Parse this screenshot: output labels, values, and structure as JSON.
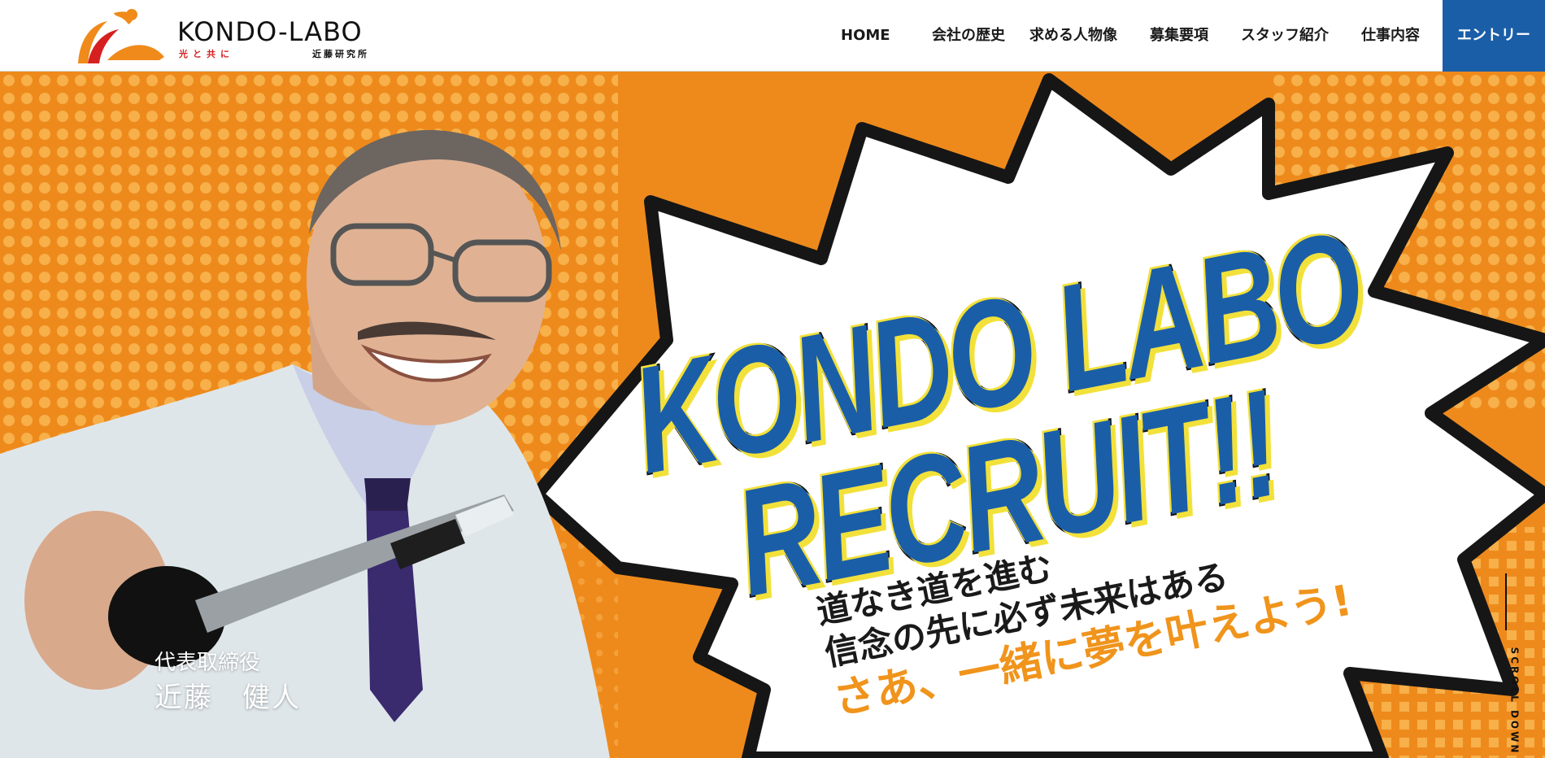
{
  "brand": {
    "logo_text": "KONDO-LABO",
    "tagline": "光と共に",
    "company_jp": "近藤研究所",
    "colors": {
      "orange": "#ee8a1c",
      "blue": "#1b5ea8",
      "red": "#d62020",
      "yellow": "#f2e13a"
    }
  },
  "nav": {
    "items": [
      {
        "label": "HOME"
      },
      {
        "label": "会社の歴史"
      },
      {
        "label": "求める人物像"
      },
      {
        "label": "募集要項"
      },
      {
        "label": "スタッフ紹介"
      },
      {
        "label": "仕事内容"
      }
    ],
    "entry_label": "エントリー"
  },
  "hero": {
    "headline_line1": "KONDO LABO",
    "headline_line2": "RECRUIT!!",
    "catch_line1": "道なき道を進む",
    "catch_line2": "信念の先に必ず未来はある",
    "catch_line3": "さあ、一緒に夢を叶えよう!",
    "ceo_title": "代表取締役",
    "ceo_name": "近藤　健人",
    "scroll_label": "SCROLL DOWN"
  }
}
